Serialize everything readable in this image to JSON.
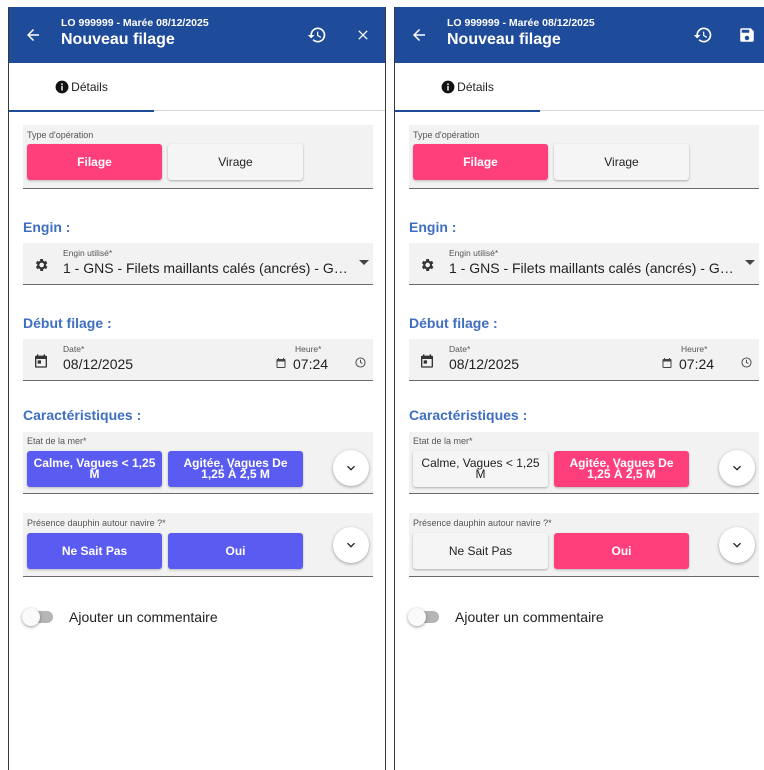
{
  "colors": {
    "header_bg": "#1f4b9b",
    "selected_pink": "#ff3f7b",
    "selected_blue": "#5a5bf0",
    "section_title": "#3f6fc0"
  },
  "panels": [
    {
      "header": {
        "subtitle": "LO 999999 - Marée 08/12/2025",
        "title": "Nouveau filage",
        "actions": [
          "history-icon",
          "close-icon"
        ]
      },
      "tab": {
        "label": "Détails",
        "icon": "info-icon"
      },
      "operation_type": {
        "label": "Type d'opération",
        "options": [
          "Filage",
          "Virage"
        ],
        "selected": "Filage"
      },
      "engin": {
        "section": "Engin :",
        "field_label": "Engin utilisé*",
        "value": "1 - GNS - Filets maillants calés (ancrés) - G…"
      },
      "debut": {
        "section": "Début filage :",
        "date_label": "Date*",
        "date_value": "08/12/2025",
        "time_label": "Heure*",
        "time_value": "07:24"
      },
      "caracteristiques": {
        "section": "Caractéristiques :",
        "etat_mer": {
          "label": "Etat de la mer*",
          "options": [
            "Calme, Vagues < 1,25 M",
            "Agitée, Vagues De 1,25 À 2,5 M"
          ],
          "style": [
            "blue",
            "blue"
          ]
        },
        "dauphin": {
          "label": "Présence dauphin autour navire ?*",
          "options": [
            "Ne Sait Pas",
            "Oui"
          ],
          "style": [
            "blue",
            "blue"
          ]
        }
      },
      "comment_toggle": {
        "label": "Ajouter un commentaire",
        "checked": false
      }
    },
    {
      "header": {
        "subtitle": "LO 999999 - Marée 08/12/2025",
        "title": "Nouveau filage",
        "actions": [
          "history-icon",
          "save-icon"
        ]
      },
      "tab": {
        "label": "Détails",
        "icon": "info-icon"
      },
      "operation_type": {
        "label": "Type d'opération",
        "options": [
          "Filage",
          "Virage"
        ],
        "selected": "Filage"
      },
      "engin": {
        "section": "Engin :",
        "field_label": "Engin utilisé*",
        "value": "1 - GNS - Filets maillants calés (ancrés) - G…"
      },
      "debut": {
        "section": "Début filage :",
        "date_label": "Date*",
        "date_value": "08/12/2025",
        "time_label": "Heure*",
        "time_value": "07:24"
      },
      "caracteristiques": {
        "section": "Caractéristiques :",
        "etat_mer": {
          "label": "Etat de la mer*",
          "options": [
            "Calme, Vagues < 1,25 M",
            "Agitée, Vagues De 1,25 À 2,5 M"
          ],
          "style": [
            "gray",
            "pink"
          ]
        },
        "dauphin": {
          "label": "Présence dauphin autour navire ?*",
          "options": [
            "Ne Sait Pas",
            "Oui"
          ],
          "style": [
            "gray",
            "pink"
          ]
        }
      },
      "comment_toggle": {
        "label": "Ajouter un commentaire",
        "checked": false
      }
    }
  ]
}
